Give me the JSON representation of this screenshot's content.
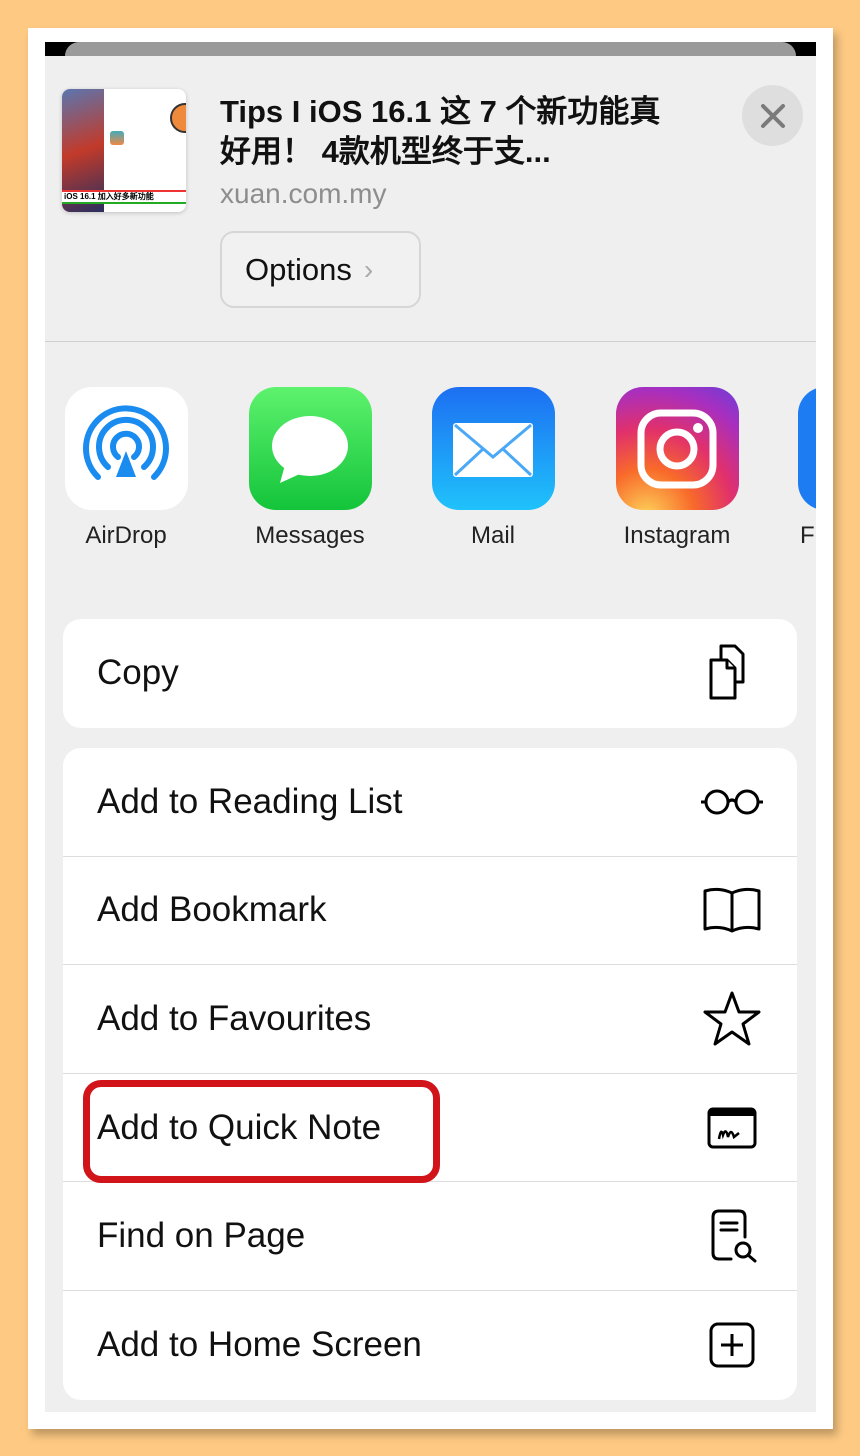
{
  "header": {
    "title": "Tips I  iOS 16.1 这 7 个新功能真好用！ 4款机型终于支...",
    "domain": "xuan.com.my",
    "options_label": "Options",
    "thumbnail_caption": "iOS 16.1  加入好多新功能"
  },
  "apps": [
    {
      "label": "AirDrop",
      "icon": "airdrop-icon"
    },
    {
      "label": "Messages",
      "icon": "messages-icon"
    },
    {
      "label": "Mail",
      "icon": "mail-icon"
    },
    {
      "label": "Instagram",
      "icon": "instagram-icon"
    },
    {
      "label": "F",
      "icon": "app-icon"
    }
  ],
  "actions_group1": [
    {
      "label": "Copy",
      "icon": "copy-icon"
    }
  ],
  "actions_group2": [
    {
      "label": "Add to Reading List",
      "icon": "glasses-icon"
    },
    {
      "label": "Add Bookmark",
      "icon": "book-icon"
    },
    {
      "label": "Add to Favourites",
      "icon": "star-icon"
    },
    {
      "label": "Add to Quick Note",
      "icon": "quick-note-icon",
      "highlighted": true
    },
    {
      "label": "Find on Page",
      "icon": "find-doc-icon"
    },
    {
      "label": "Add to Home Screen",
      "icon": "plus-square-icon"
    }
  ],
  "colors": {
    "background": "#fdc983",
    "highlight": "#d0141a",
    "sheet": "#efefef"
  }
}
